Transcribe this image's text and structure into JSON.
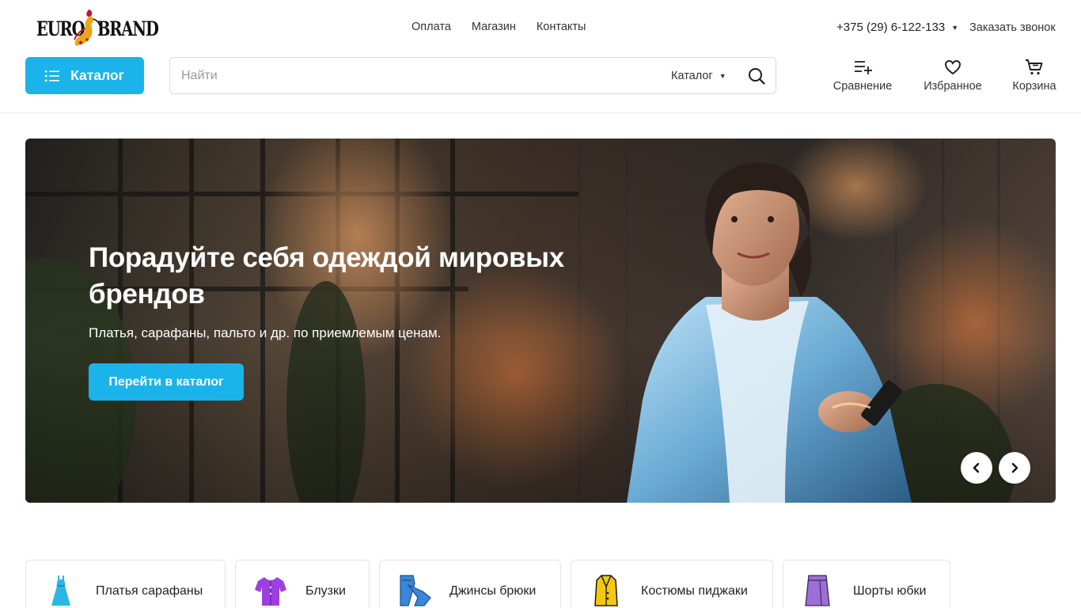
{
  "header": {
    "logo": {
      "left": "EURO",
      "right": "BRAND"
    },
    "nav": [
      "Оплата",
      "Магазин",
      "Контакты"
    ],
    "phone": "+375 (29) 6-122-133",
    "callback_label": "Заказать звонок",
    "catalog_button": "Каталог",
    "search": {
      "placeholder": "Найти",
      "scope": "Каталог"
    },
    "actions": {
      "compare": "Сравнение",
      "favorites": "Избранное",
      "cart": "Корзина"
    }
  },
  "hero": {
    "title": "Порадуйте себя одеждой мировых брендов",
    "subtitle": "Платья, сарафаны, пальто и др. по приемлемым ценам.",
    "button": "Перейти в каталог"
  },
  "categories": [
    {
      "label": "Платья сарафаны",
      "icon": "dress-icon",
      "color": "#2bb7e6"
    },
    {
      "label": "Блузки",
      "icon": "blouse-icon",
      "color": "#9b3fe0"
    },
    {
      "label": "Джинсы брюки",
      "icon": "jeans-icon",
      "color": "#3a86d8"
    },
    {
      "label": "Костюмы пиджаки",
      "icon": "jacket-icon",
      "color": "#f3c80f"
    },
    {
      "label": "Шорты юбки",
      "icon": "skirt-icon",
      "color": "#9d6fd6"
    }
  ],
  "colors": {
    "accent": "#1ab4ea"
  }
}
